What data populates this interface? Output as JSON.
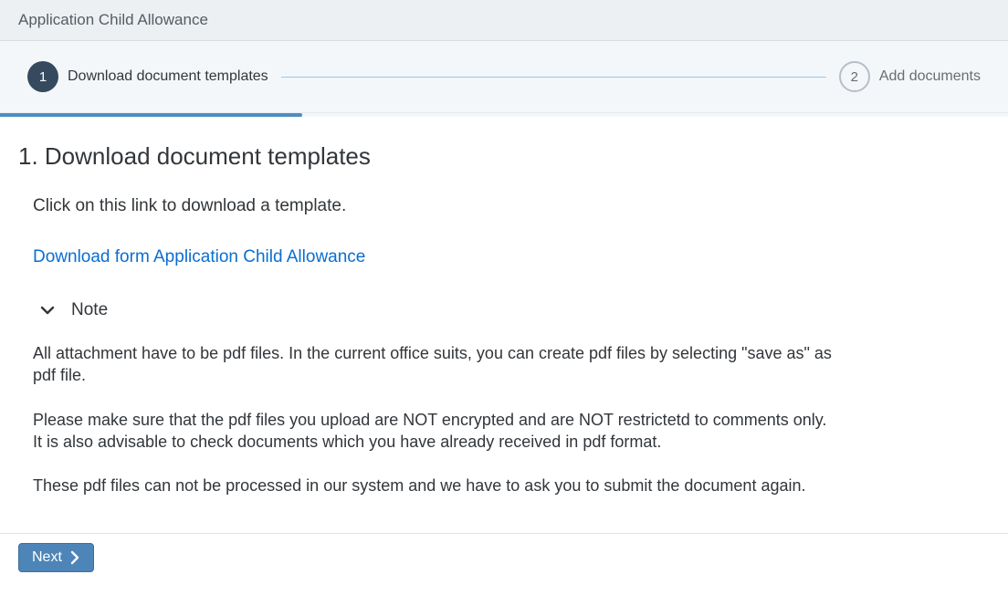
{
  "header": {
    "title": "Application Child Allowance"
  },
  "wizard": {
    "step1": {
      "number": "1",
      "label": "Download document templates"
    },
    "step2": {
      "number": "2",
      "label": "Add documents"
    }
  },
  "main": {
    "heading": "1. Download document templates",
    "intro": "Click on this link to download a template.",
    "download_link_text": "Download form Application Child Allowance",
    "note": {
      "title": "Note",
      "p1": "All attachment have to be pdf files. In the current office suits, you can create pdf files by selecting \"save as\" as pdf file.",
      "p2": "Please make sure that the pdf files you upload are NOT encrypted and are NOT restrictetd to comments only. It is also advisable to check documents which you have already received in pdf format.",
      "p3": "These pdf files can not be processed in our system and we have to ask you to submit the document again."
    }
  },
  "footer": {
    "next_label": "Next"
  }
}
